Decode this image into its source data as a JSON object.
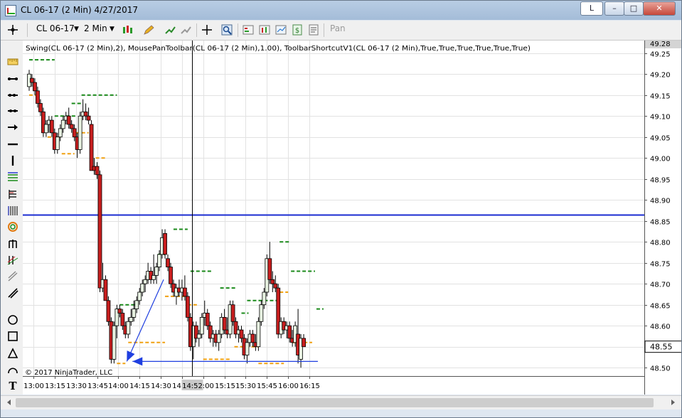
{
  "window": {
    "title": "CL 06-17 (2 Min)  4/27/2017",
    "button_l": "L",
    "minimize": "–",
    "maximize": "□",
    "close": "✕"
  },
  "toolbar": {
    "instrument": "CL 06-17",
    "interval": "2 Min",
    "pan": "Pan",
    "icons": [
      "bars-icon",
      "pencil-icon",
      "crosshair-icon",
      "zoom-icon",
      "indicators-icon",
      "strategies-icon",
      "chart-style-icon",
      "dollar-icon",
      "properties-icon"
    ]
  },
  "drawing_tools": [
    "cursor-icon",
    "ruler-icon",
    "line-icon",
    "ray-icon",
    "extended-line-icon",
    "arrow-line-icon",
    "horizontal-line-icon",
    "vertical-line-icon",
    "andrews-pitchfork-icon",
    "fibonacci-icon",
    "gann-icon",
    "fib-circle-icon",
    "fib-time-icon",
    "regression-icon",
    "trend-channel-icon",
    "ellipse-icon",
    "rectangle-icon",
    "triangle-icon",
    "arc-icon",
    "text-icon"
  ],
  "chart": {
    "indicator_label": "Swing(CL 06-17 (2 Min),2), MousePanToolbar(CL 06-17 (2 Min),1.00), ToolbarShortcutV1(CL 06-17 (2 Min),True,True,True,True,True,True)",
    "copyright": "© 2017 NinjaTrader, LLC",
    "price_labels": [
      "49.28",
      "48.55"
    ],
    "crosshair_time": "14:52",
    "horizontal_line_price": 48.865,
    "colors": {
      "up": "#e8f3e2",
      "down": "#c81e1e",
      "swing_high": "#1a8a1a",
      "swing_low": "#f0a010",
      "hline": "#1a2bd1",
      "arrow": "#1f3fe0"
    }
  },
  "chart_data": {
    "type": "candlestick",
    "y_ticks": [
      "49.25",
      "49.20",
      "49.15",
      "49.10",
      "49.05",
      "49.00",
      "48.95",
      "48.90",
      "48.85",
      "48.80",
      "48.75",
      "48.70",
      "48.65",
      "48.60",
      "48.55",
      "48.50"
    ],
    "x_ticks": [
      "13:00",
      "13:15",
      "13:30",
      "13:45",
      "14:00",
      "14:15",
      "14:30",
      "14:45",
      "15:00",
      "15:15",
      "15:30",
      "15:45",
      "16:00",
      "16:15"
    ],
    "ylim": [
      48.48,
      49.28
    ],
    "x_start": "12:57",
    "bar_interval_min": 2,
    "candles": [
      {
        "o": 49.17,
        "h": 49.21,
        "l": 49.16,
        "c": 49.2
      },
      {
        "o": 49.19,
        "h": 49.2,
        "l": 49.17,
        "c": 49.18
      },
      {
        "o": 49.18,
        "h": 49.19,
        "l": 49.15,
        "c": 49.16
      },
      {
        "o": 49.16,
        "h": 49.17,
        "l": 49.12,
        "c": 49.13
      },
      {
        "o": 49.13,
        "h": 49.14,
        "l": 49.1,
        "c": 49.11
      },
      {
        "o": 49.11,
        "h": 49.12,
        "l": 49.05,
        "c": 49.06
      },
      {
        "o": 49.06,
        "h": 49.09,
        "l": 49.05,
        "c": 49.08
      },
      {
        "o": 49.08,
        "h": 49.1,
        "l": 49.06,
        "c": 49.09
      },
      {
        "o": 49.09,
        "h": 49.1,
        "l": 49.05,
        "c": 49.06
      },
      {
        "o": 49.06,
        "h": 49.07,
        "l": 49.01,
        "c": 49.02
      },
      {
        "o": 49.02,
        "h": 49.06,
        "l": 49.01,
        "c": 49.05
      },
      {
        "o": 49.05,
        "h": 49.08,
        "l": 49.04,
        "c": 49.07
      },
      {
        "o": 49.07,
        "h": 49.1,
        "l": 49.06,
        "c": 49.09
      },
      {
        "o": 49.09,
        "h": 49.11,
        "l": 49.08,
        "c": 49.1
      },
      {
        "o": 49.1,
        "h": 49.12,
        "l": 49.07,
        "c": 49.08
      },
      {
        "o": 49.08,
        "h": 49.09,
        "l": 49.06,
        "c": 49.07
      },
      {
        "o": 49.07,
        "h": 49.08,
        "l": 49.04,
        "c": 49.05
      },
      {
        "o": 49.05,
        "h": 49.06,
        "l": 49.0,
        "c": 49.02
      },
      {
        "o": 49.02,
        "h": 49.11,
        "l": 49.01,
        "c": 49.1
      },
      {
        "o": 49.1,
        "h": 49.14,
        "l": 49.09,
        "c": 49.11
      },
      {
        "o": 49.11,
        "h": 49.13,
        "l": 49.09,
        "c": 49.1
      },
      {
        "o": 49.1,
        "h": 49.12,
        "l": 49.08,
        "c": 49.09
      },
      {
        "o": 49.08,
        "h": 49.09,
        "l": 48.97,
        "c": 48.97
      },
      {
        "o": 48.98,
        "h": 49.0,
        "l": 48.96,
        "c": 48.97
      },
      {
        "o": 48.98,
        "h": 48.99,
        "l": 48.95,
        "c": 48.96
      },
      {
        "o": 48.96,
        "h": 48.97,
        "l": 48.68,
        "c": 48.69
      },
      {
        "o": 48.69,
        "h": 48.75,
        "l": 48.68,
        "c": 48.71
      },
      {
        "o": 48.71,
        "h": 48.72,
        "l": 48.66,
        "c": 48.66
      },
      {
        "o": 48.66,
        "h": 48.67,
        "l": 48.6,
        "c": 48.61
      },
      {
        "o": 48.61,
        "h": 48.62,
        "l": 48.51,
        "c": 48.52
      },
      {
        "o": 48.52,
        "h": 48.61,
        "l": 48.51,
        "c": 48.6
      },
      {
        "o": 48.6,
        "h": 48.65,
        "l": 48.57,
        "c": 48.64
      },
      {
        "o": 48.64,
        "h": 48.65,
        "l": 48.62,
        "c": 48.63
      },
      {
        "o": 48.63,
        "h": 48.64,
        "l": 48.59,
        "c": 48.6
      },
      {
        "o": 48.6,
        "h": 48.61,
        "l": 48.57,
        "c": 48.58
      },
      {
        "o": 48.58,
        "h": 48.62,
        "l": 48.57,
        "c": 48.61
      },
      {
        "o": 48.61,
        "h": 48.64,
        "l": 48.6,
        "c": 48.62
      },
      {
        "o": 48.62,
        "h": 48.66,
        "l": 48.61,
        "c": 48.64
      },
      {
        "o": 48.64,
        "h": 48.67,
        "l": 48.63,
        "c": 48.66
      },
      {
        "o": 48.66,
        "h": 48.69,
        "l": 48.65,
        "c": 48.68
      },
      {
        "o": 48.68,
        "h": 48.71,
        "l": 48.67,
        "c": 48.7
      },
      {
        "o": 48.7,
        "h": 48.72,
        "l": 48.68,
        "c": 48.71
      },
      {
        "o": 48.71,
        "h": 48.75,
        "l": 48.7,
        "c": 48.73
      },
      {
        "o": 48.73,
        "h": 48.74,
        "l": 48.7,
        "c": 48.71
      },
      {
        "o": 48.71,
        "h": 48.77,
        "l": 48.7,
        "c": 48.72
      },
      {
        "o": 48.72,
        "h": 48.75,
        "l": 48.7,
        "c": 48.74
      },
      {
        "o": 48.74,
        "h": 48.78,
        "l": 48.73,
        "c": 48.77
      },
      {
        "o": 48.77,
        "h": 48.83,
        "l": 48.76,
        "c": 48.81
      },
      {
        "o": 48.82,
        "h": 48.83,
        "l": 48.76,
        "c": 48.77
      },
      {
        "o": 48.76,
        "h": 48.77,
        "l": 48.73,
        "c": 48.74
      },
      {
        "o": 48.74,
        "h": 48.75,
        "l": 48.69,
        "c": 48.7
      },
      {
        "o": 48.7,
        "h": 48.71,
        "l": 48.67,
        "c": 48.68
      },
      {
        "o": 48.67,
        "h": 48.7,
        "l": 48.65,
        "c": 48.69
      },
      {
        "o": 48.69,
        "h": 48.71,
        "l": 48.67,
        "c": 48.68
      },
      {
        "o": 48.68,
        "h": 48.71,
        "l": 48.66,
        "c": 48.69
      },
      {
        "o": 48.69,
        "h": 48.72,
        "l": 48.66,
        "c": 48.67
      },
      {
        "o": 48.67,
        "h": 48.68,
        "l": 48.61,
        "c": 48.62
      },
      {
        "o": 48.62,
        "h": 48.63,
        "l": 48.54,
        "c": 48.55
      },
      {
        "o": 48.55,
        "h": 48.61,
        "l": 48.52,
        "c": 48.6
      },
      {
        "o": 48.6,
        "h": 48.61,
        "l": 48.56,
        "c": 48.57
      },
      {
        "o": 48.57,
        "h": 48.59,
        "l": 48.55,
        "c": 48.58
      },
      {
        "o": 48.58,
        "h": 48.63,
        "l": 48.57,
        "c": 48.62
      },
      {
        "o": 48.62,
        "h": 48.66,
        "l": 48.6,
        "c": 48.63
      },
      {
        "o": 48.63,
        "h": 48.64,
        "l": 48.59,
        "c": 48.6
      },
      {
        "o": 48.6,
        "h": 48.61,
        "l": 48.56,
        "c": 48.57
      },
      {
        "o": 48.57,
        "h": 48.59,
        "l": 48.55,
        "c": 48.58
      },
      {
        "o": 48.58,
        "h": 48.59,
        "l": 48.55,
        "c": 48.56
      },
      {
        "o": 48.56,
        "h": 48.59,
        "l": 48.54,
        "c": 48.58
      },
      {
        "o": 48.58,
        "h": 48.63,
        "l": 48.57,
        "c": 48.62
      },
      {
        "o": 48.62,
        "h": 48.64,
        "l": 48.58,
        "c": 48.59
      },
      {
        "o": 48.59,
        "h": 48.62,
        "l": 48.57,
        "c": 48.58
      },
      {
        "o": 48.58,
        "h": 48.66,
        "l": 48.57,
        "c": 48.65
      },
      {
        "o": 48.65,
        "h": 48.66,
        "l": 48.6,
        "c": 48.61
      },
      {
        "o": 48.61,
        "h": 48.62,
        "l": 48.57,
        "c": 48.58
      },
      {
        "o": 48.58,
        "h": 48.6,
        "l": 48.56,
        "c": 48.59
      },
      {
        "o": 48.59,
        "h": 48.6,
        "l": 48.56,
        "c": 48.57
      },
      {
        "o": 48.57,
        "h": 48.58,
        "l": 48.52,
        "c": 48.53
      },
      {
        "o": 48.53,
        "h": 48.57,
        "l": 48.51,
        "c": 48.56
      },
      {
        "o": 48.56,
        "h": 48.59,
        "l": 48.55,
        "c": 48.58
      },
      {
        "o": 48.58,
        "h": 48.59,
        "l": 48.55,
        "c": 48.56
      },
      {
        "o": 48.56,
        "h": 48.58,
        "l": 48.54,
        "c": 48.55
      },
      {
        "o": 48.55,
        "h": 48.62,
        "l": 48.54,
        "c": 48.61
      },
      {
        "o": 48.61,
        "h": 48.66,
        "l": 48.6,
        "c": 48.65
      },
      {
        "o": 48.65,
        "h": 48.69,
        "l": 48.64,
        "c": 48.68
      },
      {
        "o": 48.68,
        "h": 48.77,
        "l": 48.67,
        "c": 48.76
      },
      {
        "o": 48.76,
        "h": 48.8,
        "l": 48.7,
        "c": 48.71
      },
      {
        "o": 48.71,
        "h": 48.73,
        "l": 48.68,
        "c": 48.7
      },
      {
        "o": 48.7,
        "h": 48.72,
        "l": 48.68,
        "c": 48.69
      },
      {
        "o": 48.69,
        "h": 48.7,
        "l": 48.57,
        "c": 48.58
      },
      {
        "o": 48.58,
        "h": 48.62,
        "l": 48.57,
        "c": 48.61
      },
      {
        "o": 48.61,
        "h": 48.62,
        "l": 48.58,
        "c": 48.59
      },
      {
        "o": 48.59,
        "h": 48.61,
        "l": 48.57,
        "c": 48.6
      },
      {
        "o": 48.6,
        "h": 48.61,
        "l": 48.56,
        "c": 48.57
      },
      {
        "o": 48.57,
        "h": 48.59,
        "l": 48.55,
        "c": 48.56
      },
      {
        "o": 48.56,
        "h": 48.61,
        "l": 48.55,
        "c": 48.6
      },
      {
        "o": 48.58,
        "h": 48.64,
        "l": 48.51,
        "c": 48.53
      },
      {
        "o": 48.52,
        "h": 48.58,
        "l": 48.5,
        "c": 48.57
      },
      {
        "o": 48.57,
        "h": 48.58,
        "l": 48.55,
        "c": 48.55
      }
    ],
    "swing_highs": [
      {
        "p": 49.234,
        "from": "12:57",
        "to": "13:15"
      },
      {
        "p": 49.1,
        "from": "13:15",
        "to": "13:30"
      },
      {
        "p": 49.13,
        "from": "13:27",
        "to": "13:34"
      },
      {
        "p": 49.15,
        "from": "13:34",
        "to": "13:59"
      },
      {
        "p": 48.65,
        "from": "14:01",
        "to": "14:12"
      },
      {
        "p": 48.77,
        "from": "14:28",
        "to": "14:33"
      },
      {
        "p": 48.83,
        "from": "14:39",
        "to": "14:49"
      },
      {
        "p": 48.73,
        "from": "14:51",
        "to": "15:07"
      },
      {
        "p": 48.69,
        "from": "15:12",
        "to": "15:23"
      },
      {
        "p": 48.63,
        "from": "15:27",
        "to": "15:32"
      },
      {
        "p": 48.66,
        "from": "15:31",
        "to": "15:54"
      },
      {
        "p": 48.8,
        "from": "15:54",
        "to": "16:01"
      },
      {
        "p": 48.73,
        "from": "16:02",
        "to": "16:19"
      },
      {
        "p": 48.64,
        "from": "16:20",
        "to": "16:25"
      }
    ],
    "swing_lows": [
      {
        "p": 49.15,
        "from": "12:57",
        "to": "13:04"
      },
      {
        "p": 49.05,
        "from": "13:10",
        "to": "13:19"
      },
      {
        "p": 49.01,
        "from": "13:20",
        "to": "13:29"
      },
      {
        "p": 49.06,
        "from": "13:30",
        "to": "13:39"
      },
      {
        "p": 49.0,
        "from": "13:40",
        "to": "13:51"
      },
      {
        "p": 48.51,
        "from": "13:59",
        "to": "14:05"
      },
      {
        "p": 48.56,
        "from": "14:07",
        "to": "14:33"
      },
      {
        "p": 48.67,
        "from": "14:33",
        "to": "14:47"
      },
      {
        "p": 48.65,
        "from": "14:49",
        "to": "14:57"
      },
      {
        "p": 48.52,
        "from": "15:00",
        "to": "15:19"
      },
      {
        "p": 48.55,
        "from": "15:22",
        "to": "15:39"
      },
      {
        "p": 48.51,
        "from": "15:39",
        "to": "15:57"
      },
      {
        "p": 48.68,
        "from": "15:54",
        "to": "16:00"
      },
      {
        "p": 48.56,
        "from": "16:03",
        "to": "16:17"
      }
    ],
    "arrows": [
      {
        "from_time": "14:32",
        "from_price": 48.71,
        "to_time": "14:06",
        "to_price": 48.515
      },
      {
        "from_time": "16:21",
        "from_price": 48.515,
        "to_time": "14:10",
        "to_price": 48.515
      }
    ]
  }
}
